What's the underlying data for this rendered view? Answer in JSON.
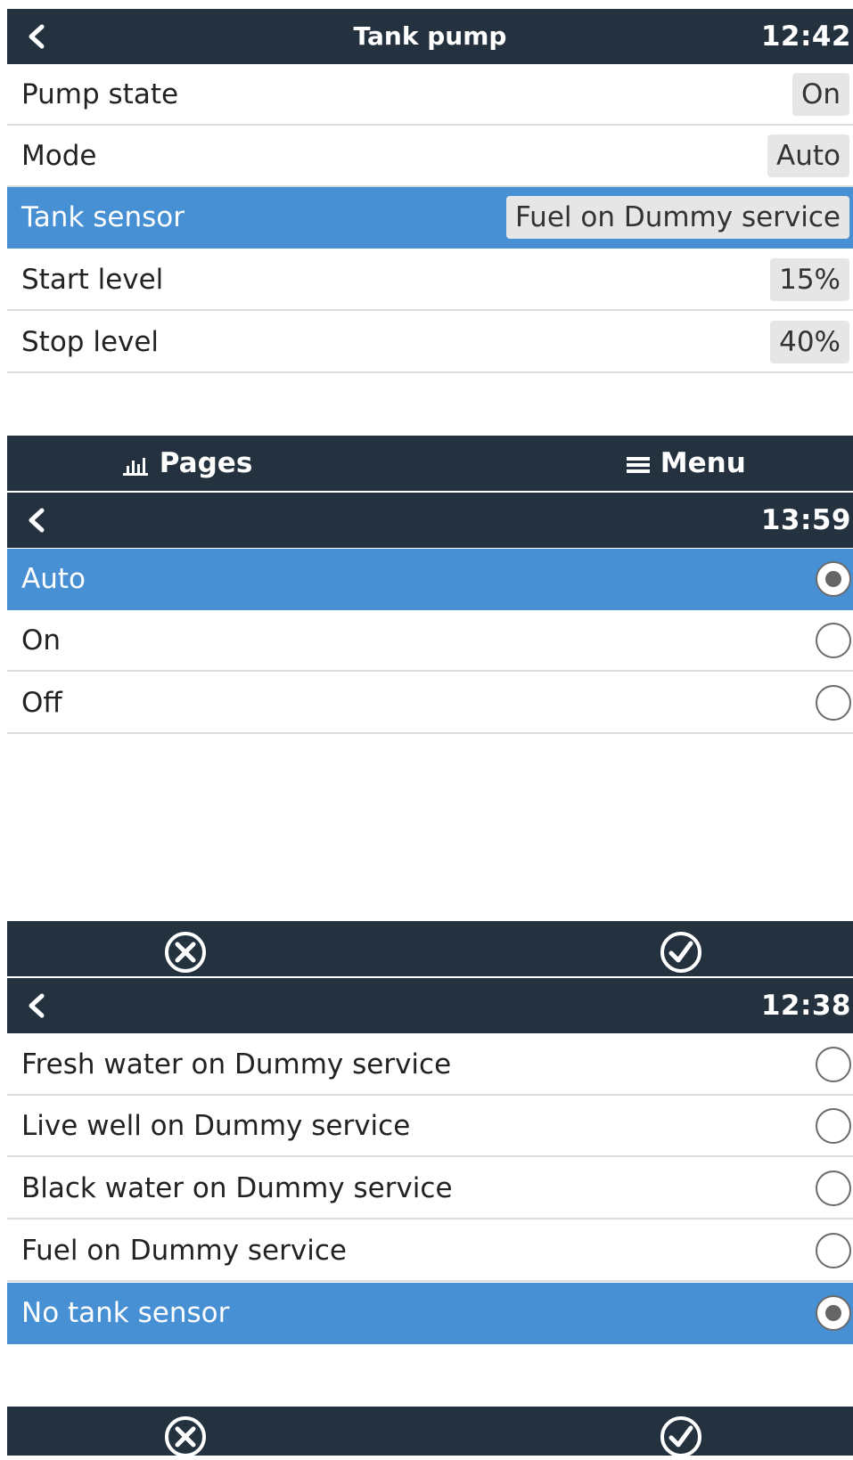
{
  "colors": {
    "header_bg": "#24313f",
    "selection_bg": "#4790d4",
    "value_bg": "#e6e6e6"
  },
  "screen1": {
    "title": "Tank pump",
    "clock": "12:42",
    "rows": [
      {
        "label": "Pump state",
        "value": "On"
      },
      {
        "label": "Mode",
        "value": "Auto"
      },
      {
        "label": "Tank sensor",
        "value": "Fuel on Dummy service",
        "selected": true
      },
      {
        "label": "Start level",
        "value": "15%"
      },
      {
        "label": "Stop level",
        "value": "40%"
      }
    ],
    "nav": {
      "pages_label": "Pages",
      "pages_icon": "bar-chart-icon",
      "menu_label": "Menu",
      "menu_icon": "hamburger-icon"
    }
  },
  "screen2": {
    "clock": "13:59",
    "options": [
      {
        "label": "Auto",
        "checked": true,
        "selected": true
      },
      {
        "label": "On",
        "checked": false
      },
      {
        "label": "Off",
        "checked": false
      }
    ],
    "actions": {
      "cancel_icon": "cancel-circle-icon",
      "confirm_icon": "check-circle-icon"
    }
  },
  "screen3": {
    "clock": "12:38",
    "options": [
      {
        "label": "Fresh water on Dummy service",
        "checked": false
      },
      {
        "label": "Live well on Dummy service",
        "checked": false
      },
      {
        "label": "Black water on Dummy service",
        "checked": false
      },
      {
        "label": "Fuel on Dummy service",
        "checked": false
      },
      {
        "label": "No tank sensor",
        "checked": true,
        "selected": true
      }
    ],
    "actions": {
      "cancel_icon": "cancel-circle-icon",
      "confirm_icon": "check-circle-icon"
    }
  }
}
